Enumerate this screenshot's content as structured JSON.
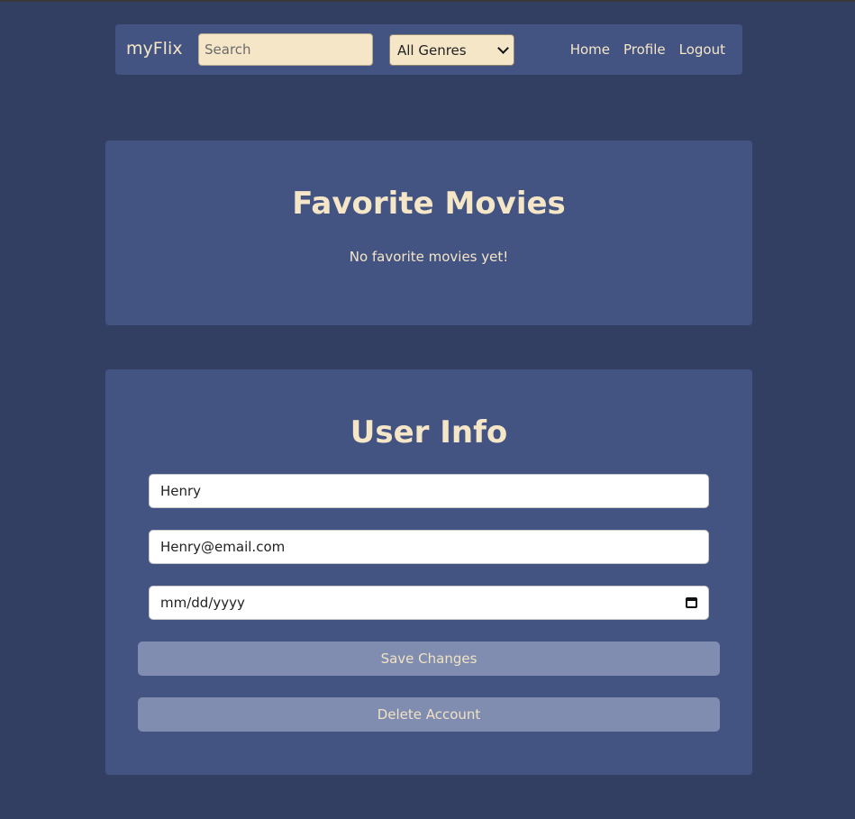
{
  "navbar": {
    "brand": "myFlix",
    "search_placeholder": "Search",
    "genre_selected": "All Genres",
    "links": [
      "Home",
      "Profile",
      "Logout"
    ]
  },
  "favorites": {
    "title": "Favorite Movies",
    "empty_message": "No favorite movies yet!"
  },
  "user_info": {
    "title": "User Info",
    "username_value": "Henry",
    "email_value": "Henry@email.com",
    "birthday_placeholder": "mm/dd/yyyy",
    "save_label": "Save Changes",
    "delete_label": "Delete Account"
  },
  "icons": {
    "genre_select": "chevron-down-icon",
    "date_picker": "calendar-icon"
  },
  "colors": {
    "page_background": "#323e62",
    "card_background": "#435482",
    "accent_text": "#f5e6c8",
    "input_background": "#f5e6c8",
    "button_background": "#808db0"
  }
}
